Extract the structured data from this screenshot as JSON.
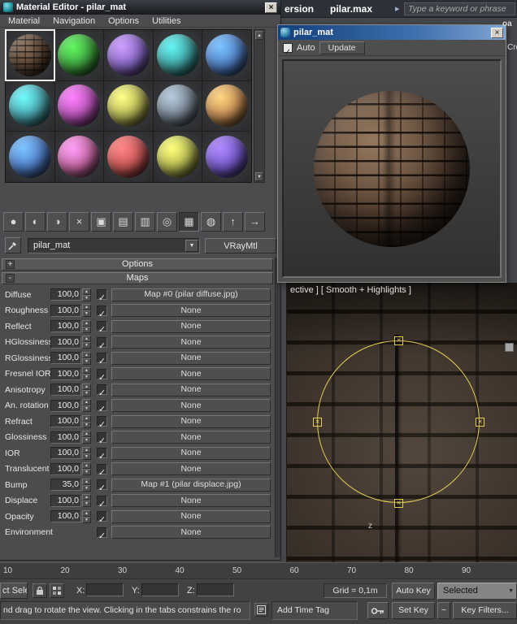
{
  "glyphs": {
    "check": "✓",
    "spin_up": "▲",
    "spin_down": "▼",
    "dropdown_arrow": "▼",
    "close": "×",
    "chevron_right": "▸",
    "gizmo_handle": "×",
    "scroll_up": "▲",
    "scroll_down": "▼",
    "tangent": "~"
  },
  "app_top": {
    "title_fragment": "ersion",
    "document": "pilar.max",
    "search_placeholder": "Type a keyword or phrase"
  },
  "fragments": {
    "top_right": "oa",
    "side_right": "Crea"
  },
  "material_editor": {
    "title": "Material Editor - pilar_mat",
    "menus": [
      "Material",
      "Navigation",
      "Options",
      "Utilities"
    ],
    "samples": [
      {
        "texture": "brick",
        "selected": true
      },
      {
        "color": "#3da03d"
      },
      {
        "color": "#8465c2"
      },
      {
        "color": "#3f9f9f"
      },
      {
        "color": "#4f7ec4"
      },
      {
        "color": "#47a3ab"
      },
      {
        "color": "#b653b6"
      },
      {
        "color": "#b4b455"
      },
      {
        "color": "#75828f"
      },
      {
        "color": "#c28a52"
      },
      {
        "color": "#4f7ec8"
      },
      {
        "color": "#c465a0"
      },
      {
        "color": "#c85555"
      },
      {
        "color": "#b3b64f"
      },
      {
        "color": "#7257c8"
      }
    ],
    "toolbar_icons": [
      {
        "name": "get-material-icon",
        "glyph": "●"
      },
      {
        "name": "put-material-to-scene-icon",
        "glyph": "◐"
      },
      {
        "name": "assign-material-to-selection-icon",
        "glyph": "◑"
      },
      {
        "name": "reset-material-icon",
        "glyph": "×"
      },
      {
        "name": "make-material-copy-icon",
        "glyph": "▣"
      },
      {
        "name": "make-unique-icon",
        "glyph": "▤"
      },
      {
        "name": "put-to-library-icon",
        "glyph": "▥"
      },
      {
        "name": "material-effects-channel-icon",
        "glyph": "◎"
      },
      {
        "name": "show-map-in-viewport-icon",
        "glyph": "▦",
        "pressed": true
      },
      {
        "name": "show-end-result-icon",
        "glyph": "◍"
      },
      {
        "name": "go-to-parent-icon",
        "glyph": "↑"
      },
      {
        "name": "go-forward-to-sibling-icon",
        "glyph": "→"
      }
    ],
    "material_name": "pilar_mat",
    "material_type": "VRayMtl",
    "rollouts": {
      "options_label": "Options",
      "options_toggle": "+",
      "maps_label": "Maps",
      "maps_toggle": "-"
    },
    "maps_rows": [
      {
        "label": "Diffuse",
        "value": "100,0",
        "checked": true,
        "map": "Map #0 (pilar diffuse.jpg)"
      },
      {
        "label": "Roughness",
        "value": "100,0",
        "checked": true,
        "map": "None"
      },
      {
        "label": "Reflect",
        "value": "100,0",
        "checked": true,
        "map": "None"
      },
      {
        "label": "HGlossiness",
        "value": "100,0",
        "checked": true,
        "map": "None"
      },
      {
        "label": "RGlossiness",
        "value": "100,0",
        "checked": true,
        "map": "None"
      },
      {
        "label": "Fresnel IOR",
        "value": "100,0",
        "checked": true,
        "map": "None"
      },
      {
        "label": "Anisotropy",
        "value": "100,0",
        "checked": true,
        "map": "None"
      },
      {
        "label": "An. rotation",
        "value": "100,0",
        "checked": true,
        "map": "None"
      },
      {
        "label": "Refract",
        "value": "100,0",
        "checked": true,
        "map": "None"
      },
      {
        "label": "Glossiness",
        "value": "100,0",
        "checked": true,
        "map": "None"
      },
      {
        "label": "IOR",
        "value": "100,0",
        "checked": true,
        "map": "None"
      },
      {
        "label": "Translucent",
        "value": "100,0",
        "checked": true,
        "map": "None"
      },
      {
        "label": "Bump",
        "value": "35,0",
        "checked": true,
        "map": "Map #1 (pilar displace.jpg)"
      },
      {
        "label": "Displace",
        "value": "100,0",
        "checked": true,
        "map": "None"
      },
      {
        "label": "Opacity",
        "value": "100,0",
        "checked": true,
        "map": "None"
      },
      {
        "label": "Environment",
        "value": null,
        "checked": true,
        "map": "None"
      }
    ]
  },
  "preview_window": {
    "title": "pilar_mat",
    "auto_label": "Auto",
    "update_label": "Update"
  },
  "viewport": {
    "label": "ective ] [ Smooth + Highlights ]",
    "axis": "z"
  },
  "timeline": {
    "ticks": [
      "10",
      "20",
      "30",
      "40",
      "50",
      "60",
      "70",
      "80",
      "90"
    ]
  },
  "status": {
    "left_fragment": "ct Sele",
    "x_label": "X:",
    "y_label": "Y:",
    "z_label": "Z:",
    "grid": "Grid = 0,1m",
    "auto_key": "Auto Key",
    "selected": "Selected",
    "set_key": "Set Key",
    "key_filters": "Key Filters...",
    "prompt": "nd drag to rotate the view. Clicking in the tabs constrains the ro",
    "add_time_tag": "Add Time Tag"
  }
}
